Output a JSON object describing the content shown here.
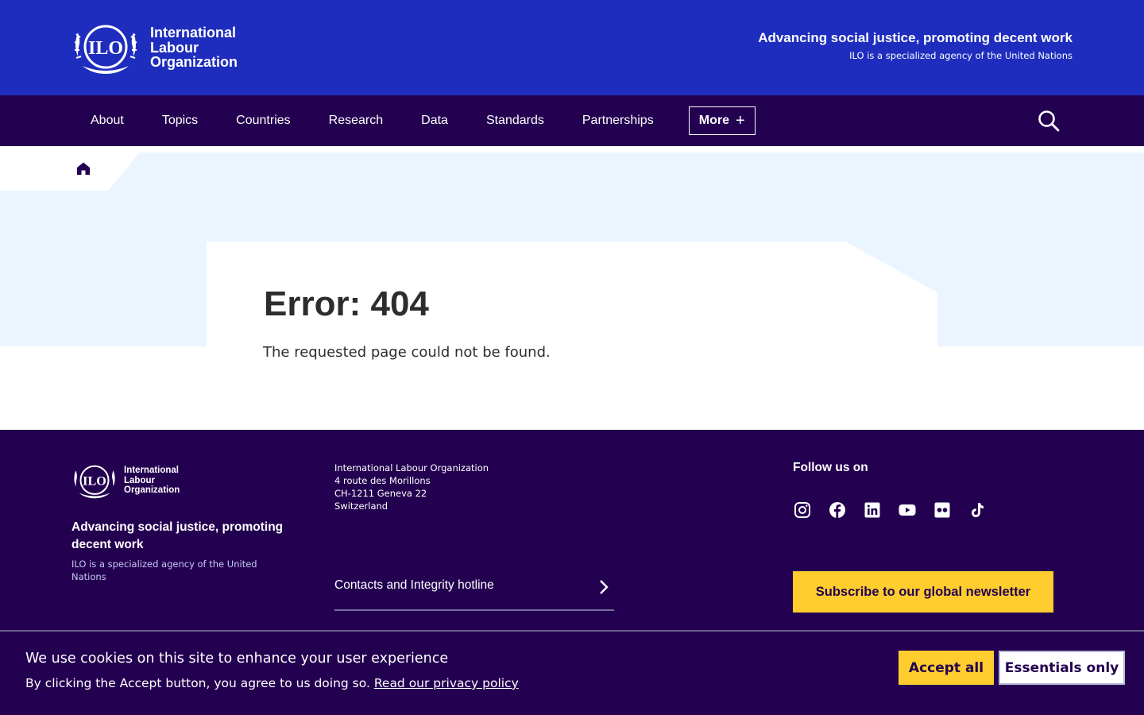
{
  "header": {
    "logo_line1": "International",
    "logo_line2": "Labour",
    "logo_line3": "Organization",
    "tagline": "Advancing social justice, promoting decent work",
    "subtagline": "ILO is a specialized agency of the United Nations"
  },
  "nav": {
    "items": [
      {
        "label": "About"
      },
      {
        "label": "Topics"
      },
      {
        "label": "Countries"
      },
      {
        "label": "Research"
      },
      {
        "label": "Data"
      },
      {
        "label": "Standards"
      },
      {
        "label": "Partnerships"
      }
    ],
    "more_label": "More",
    "more_icon": "plus-icon",
    "search_icon": "search-icon"
  },
  "breadcrumb": {
    "home_icon": "home-icon"
  },
  "error": {
    "title": "Error: 404",
    "message": "The requested page could not be found."
  },
  "footer": {
    "logo_line1": "International",
    "logo_line2": "Labour",
    "logo_line3": "Organization",
    "tagline": "Advancing social justice, promoting decent work",
    "subtagline": "ILO is a specialized agency of the United Nations",
    "address": [
      "International Labour Organization",
      "4 route des Morillons",
      "CH-1211 Geneva 22",
      "Switzerland"
    ],
    "contacts_label": "Contacts and Integrity hotline",
    "follow_label": "Follow us on",
    "social_icons": [
      "instagram-icon",
      "facebook-icon",
      "linkedin-icon",
      "youtube-icon",
      "flickr-icon",
      "tiktok-icon"
    ],
    "newsletter_label": "Subscribe to our global newsletter"
  },
  "cookie": {
    "title": "We use cookies on this site to enhance your user experience",
    "text": "By clicking the Accept button, you agree to us doing so.",
    "link": "Read our privacy policy",
    "accept_label": "Accept all",
    "essentials_label": "Essentials only"
  },
  "colors": {
    "header_blue": "#1e2dbe",
    "nav_purple": "#230050",
    "hero_light": "#ebf5ff",
    "accent_yellow": "#ffcd2d"
  }
}
